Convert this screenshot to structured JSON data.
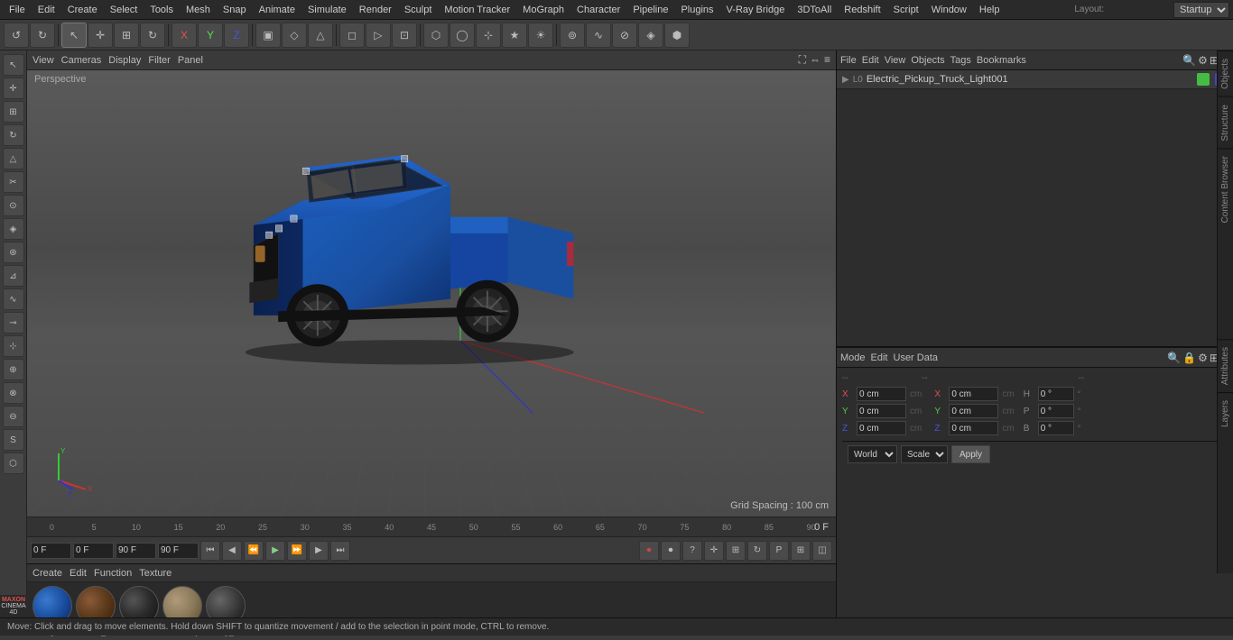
{
  "menu": {
    "items": [
      "File",
      "Edit",
      "Create",
      "Select",
      "Tools",
      "Mesh",
      "Snap",
      "Animate",
      "Simulate",
      "Render",
      "Sculpt",
      "Motion Tracker",
      "MoGraph",
      "Character",
      "Pipeline",
      "Plugins",
      "V-Ray Bridge",
      "3DToAll",
      "Redshift",
      "Script",
      "Window",
      "Help"
    ]
  },
  "layout": {
    "label": "Layout:",
    "value": "Startup"
  },
  "toolbar": {
    "buttons": [
      "↺",
      "⊞",
      "✛",
      "✙",
      "↻",
      "X",
      "Y",
      "Z",
      "▣",
      "▷",
      "⬡",
      "⬢",
      "◇",
      "△",
      "◻",
      "⊡",
      "⊹",
      "★",
      "⊚",
      "▱",
      "☐",
      "☑"
    ]
  },
  "left_toolbar": {
    "buttons": [
      "↖",
      "✛",
      "▣",
      "↻",
      "✙",
      "►",
      "⬡",
      "⬢",
      "◻",
      "△",
      "⊏",
      "⊐",
      "⊿",
      "⊘",
      "⊙",
      "⊛",
      "◈"
    ]
  },
  "viewport": {
    "menu_items": [
      "View",
      "Cameras",
      "Display",
      "Filter",
      "Panel"
    ],
    "label": "Perspective",
    "grid_spacing": "Grid Spacing : 100 cm"
  },
  "timeline": {
    "markers": [
      "0",
      "5",
      "10",
      "15",
      "20",
      "25",
      "30",
      "35",
      "40",
      "45",
      "50",
      "55",
      "60",
      "65",
      "70",
      "75",
      "80",
      "85",
      "90"
    ],
    "current_frame": "0 F"
  },
  "playback": {
    "frame_start": "0 F",
    "frame_current": "0 F",
    "frame_end": "90 F",
    "frame_end2": "90 F"
  },
  "materials": {
    "menu_items": [
      "Create",
      "Edit",
      "Function",
      "Texture"
    ],
    "items": [
      {
        "label": "BodyCar",
        "color": "#1a4fa0",
        "type": "diffuse"
      },
      {
        "label": "Seats_ill",
        "color": "#5a3a1a",
        "type": "diffuse"
      },
      {
        "label": "Underca",
        "color": "#2a2a2a",
        "type": "dark"
      },
      {
        "label": "Interior |",
        "color": "#8a7a5a",
        "type": "diffuse"
      },
      {
        "label": "Body_illi",
        "color": "#3a3a3a",
        "type": "dark"
      }
    ]
  },
  "object_manager": {
    "menu_items": [
      "File",
      "Edit",
      "View",
      "Objects",
      "Tags",
      "Bookmarks"
    ],
    "object_name": "Electric_Pickup_Truck_Light001",
    "object_color_green": "#44bb44",
    "object_color_blue": "#4444cc"
  },
  "attributes": {
    "menu_items": [
      "Mode",
      "Edit",
      "User Data"
    ],
    "coords": {
      "x_pos": "0 cm",
      "y_pos": "0 cm",
      "z_pos": "0 cm",
      "x_size": "H",
      "h_val": "0 °",
      "y_size": "P",
      "p_val": "0 °",
      "z_size": "B",
      "b_val": "0 °"
    },
    "placeholders": {
      "x": "0 cm",
      "y": "0 cm",
      "z": "0 cm",
      "sx": "0 cm",
      "sy": "0 cm",
      "sz": "0 cm"
    },
    "coord_labels": {
      "x": "X",
      "y": "Y",
      "z": "Z",
      "h": "H",
      "p": "P",
      "b": "B"
    },
    "transform": {
      "world_label": "World",
      "scale_label": "Scale",
      "apply_label": "Apply"
    }
  },
  "status_bar": {
    "text": "Move: Click and drag to move elements. Hold down SHIFT to quantize movement / add to the selection in point mode, CTRL to remove."
  },
  "right_vtabs": [
    "Objects",
    "Structure",
    "Content Browser",
    "Layers",
    "Attributes"
  ],
  "coord_section": {
    "sep_labels": [
      "--",
      "--",
      "--"
    ]
  }
}
